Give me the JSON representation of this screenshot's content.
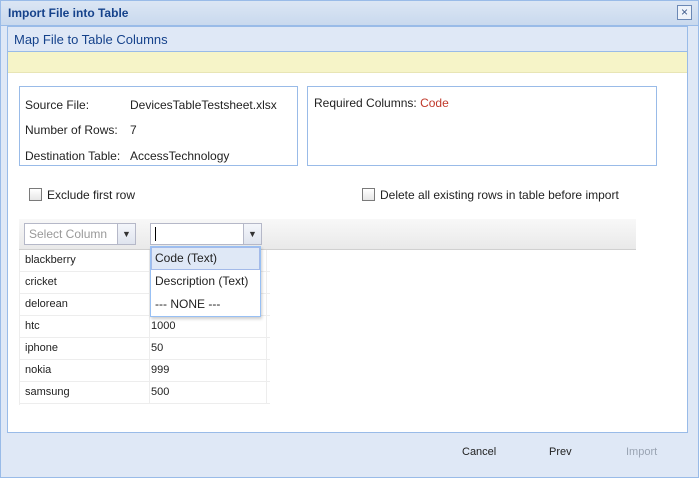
{
  "window": {
    "title": "Import File into Table"
  },
  "section": {
    "title": "Map File to Table Columns"
  },
  "info": {
    "source_file_label": "Source File:",
    "source_file_value": "DevicesTableTestsheet.xlsx",
    "rows_label": "Number of Rows:",
    "rows_value": "7",
    "destination_label": "Destination Table:",
    "destination_value": "AccessTechnology",
    "required_label": "Required Columns:",
    "required_value": "Code"
  },
  "options": {
    "exclude_first_row_label": "Exclude first row",
    "delete_rows_label": "Delete all existing rows in table before import"
  },
  "grid": {
    "column1_placeholder": "Select Column",
    "column2_value": "",
    "rows": [
      {
        "col1": "blackberry",
        "col2": ""
      },
      {
        "col1": "cricket",
        "col2": ""
      },
      {
        "col1": "delorean",
        "col2": ""
      },
      {
        "col1": "htc",
        "col2": "1000"
      },
      {
        "col1": "iphone",
        "col2": "50"
      },
      {
        "col1": "nokia",
        "col2": "999"
      },
      {
        "col1": "samsung",
        "col2": "500"
      }
    ]
  },
  "dropdown": {
    "items": [
      {
        "label": "Code (Text)",
        "selected": true
      },
      {
        "label": "Description (Text)",
        "selected": false
      },
      {
        "label": "--- NONE ---",
        "selected": false
      }
    ]
  },
  "footer": {
    "cancel_label": "Cancel",
    "prev_label": "Prev",
    "import_label": "Import"
  },
  "colors": {
    "accent": "#15428b",
    "required": "#c0392b",
    "panel_bg": "#dfe8f6",
    "message_bg": "#f6f4c8"
  },
  "icons": {
    "close": "close-icon",
    "combo_trigger": "chevron-down-icon",
    "checkbox": "checkbox-icon"
  }
}
